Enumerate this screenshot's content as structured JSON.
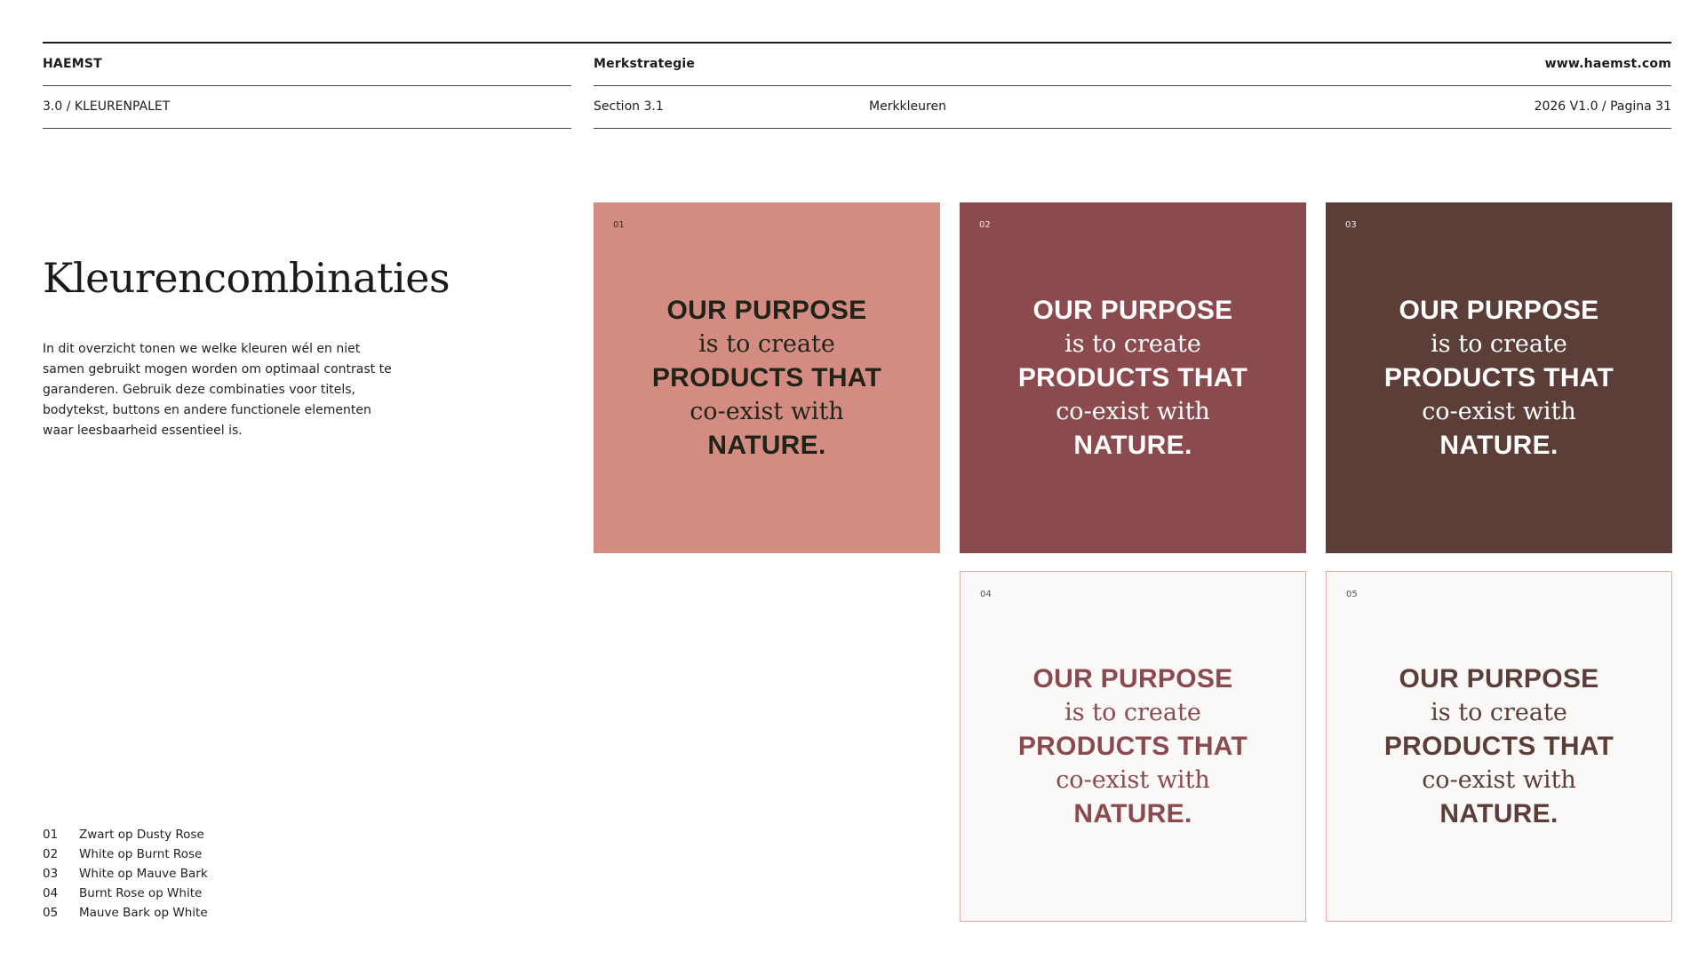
{
  "header": {
    "brand": "HAEMST",
    "doc_title": "Merkstrategie",
    "website": "www.haemst.com",
    "section_path": "3.0 / KLEURENPALET",
    "section_num": "Section 3.1",
    "section_topic": "Merkkleuren",
    "page_info": "2026 V1.0 / Pagina 31"
  },
  "main": {
    "heading": "Kleurencombinaties",
    "intro": "In dit overzicht tonen we welke kleuren wél en niet samen gebruikt mogen worden om optimaal contrast te garanderen. Gebruik deze combinaties voor titels, bodytekst, buttons en andere functionele elementen waar leesbaarheid essentieel is."
  },
  "quote": {
    "line1": "OUR PURPOSE",
    "line2": "is to create",
    "line3": "PRODUCTS THAT",
    "line4": "co-exist with",
    "line5": "NATURE."
  },
  "cards": [
    {
      "tag": "01",
      "bg": "#d48c82",
      "fg": "#1f2318"
    },
    {
      "tag": "02",
      "bg": "#8b4a4e",
      "fg": "#ffffff"
    },
    {
      "tag": "03",
      "bg": "#5b3e37",
      "fg": "#ffffff"
    },
    {
      "tag": "04",
      "bg": "#fbf9f7",
      "fg": "#8b4a4e"
    },
    {
      "tag": "05",
      "bg": "#fbf9f7",
      "fg": "#5b3e37"
    }
  ],
  "legend": [
    {
      "num": "01",
      "label": "Zwart op Dusty Rose"
    },
    {
      "num": "02",
      "label": "White op Burnt Rose"
    },
    {
      "num": "03",
      "label": "White op Mauve Bark"
    },
    {
      "num": "04",
      "label": "Burnt Rose op White"
    },
    {
      "num": "05",
      "label": "Mauve Bark op White"
    }
  ]
}
